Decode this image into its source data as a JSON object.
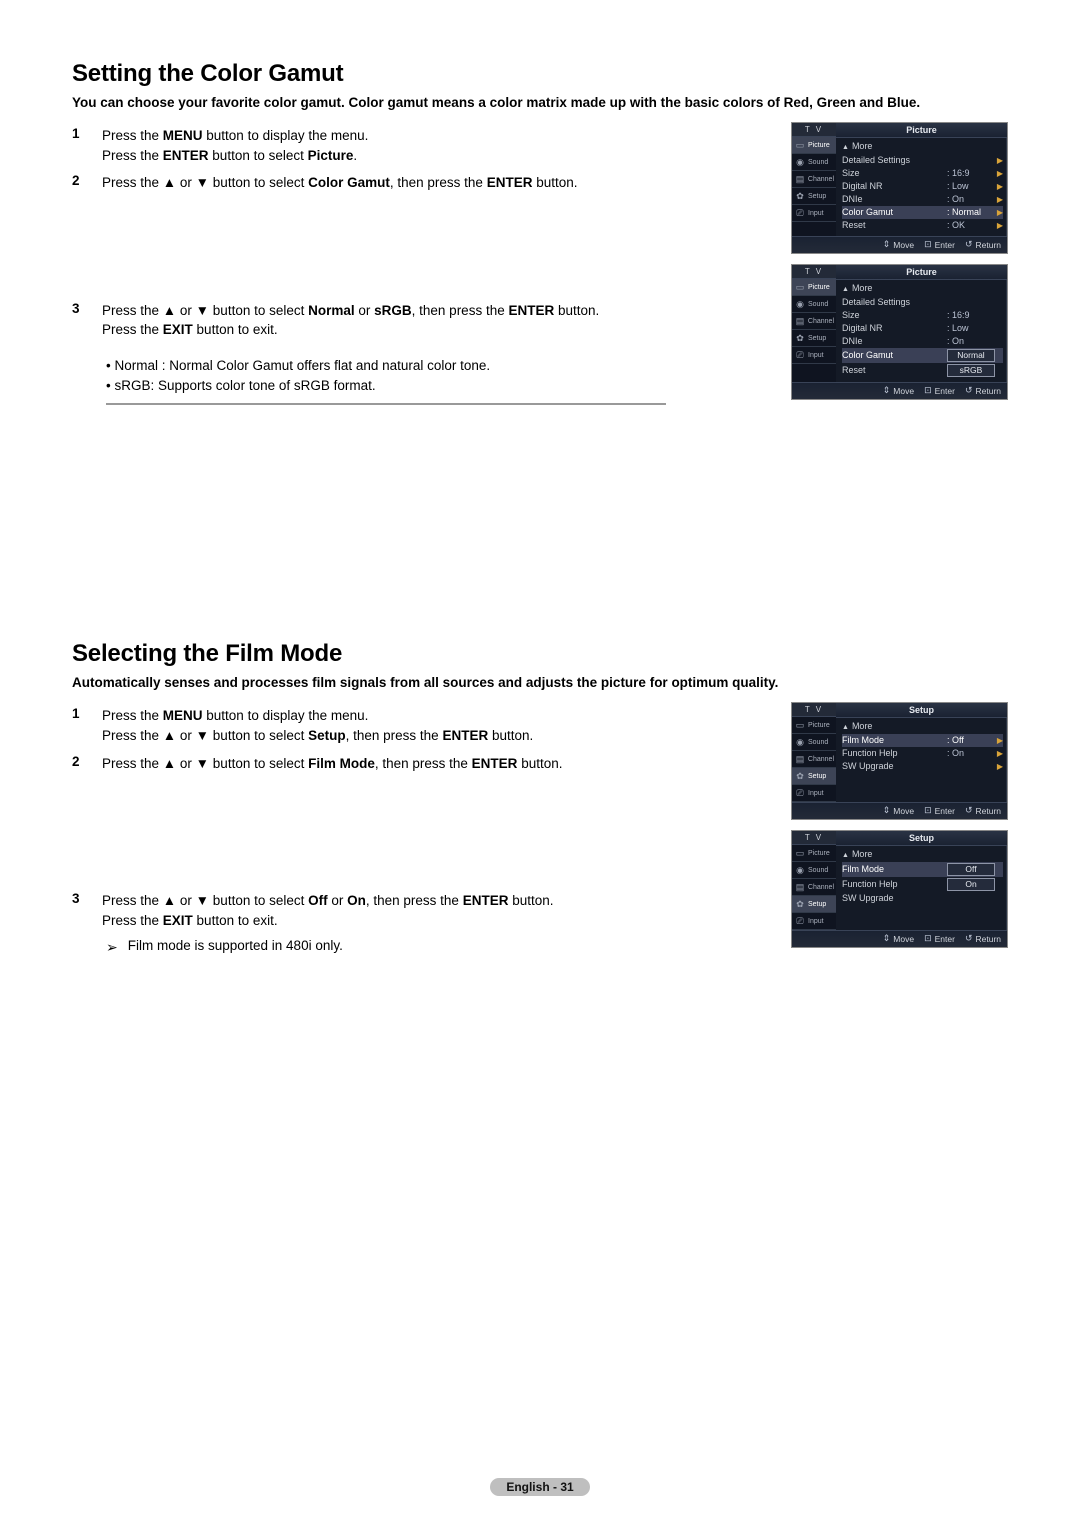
{
  "glyphs": {
    "up": "▲",
    "down": "▼",
    "updown": "▲▼",
    "tri_r": "▶",
    "enter_sym": "⊡",
    "return_sym": "↺",
    "arrow_r": "➤",
    "bullet": "•",
    "note": "➢",
    "updown_sym": "⇕"
  },
  "section1": {
    "heading": "Setting the Color Gamut",
    "intro": "You can choose your favorite color gamut. Color gamut means a color matrix made up with the basic colors of Red, Green and Blue.",
    "step1": {
      "num": "1",
      "l1a": "Press the ",
      "l1b": "MENU",
      "l1c": " button to display the menu.",
      "l2a": "Press the ",
      "l2b": "ENTER",
      "l2c": " button to select ",
      "l2d": "Picture",
      "l2e": "."
    },
    "step2": {
      "num": "2",
      "a": "Press the ",
      "b": " or ",
      "c": " button to select ",
      "d": "Color Gamut",
      "e": ", then press the ",
      "f": "ENTER",
      "g": " button."
    },
    "step3": {
      "num": "3",
      "a": "Press the ",
      "b": " or ",
      "c": " button to select ",
      "d": "Normal",
      "e": " or ",
      "f": "sRGB",
      "g": ", then press the ",
      "h": "ENTER",
      "i": " button.",
      "l2a": "Press the ",
      "l2b": "EXIT",
      "l2c": " button to exit."
    },
    "bul1": {
      "a": "Normal",
      "b": " : Normal Color Gamut offers flat and natural color tone."
    },
    "bul2": {
      "a": "sRGB",
      "b": ": Supports color tone of sRGB format."
    },
    "osd1": {
      "title": "Picture",
      "more": "More",
      "rows": [
        {
          "label": "Detailed Settings",
          "val": "",
          "arrow": true
        },
        {
          "label": "Size",
          "val": ": 16:9",
          "arrow": true
        },
        {
          "label": "Digital NR",
          "val": ": Low",
          "arrow": true
        },
        {
          "label": "DNIe",
          "val": ": On",
          "arrow": true
        },
        {
          "label": "Color Gamut",
          "val": ": Normal",
          "arrow": true,
          "hl": true
        },
        {
          "label": "Reset",
          "val": ": OK",
          "arrow": true
        }
      ]
    },
    "osd2": {
      "title": "Picture",
      "more": "More",
      "rows": [
        {
          "label": "Detailed Settings",
          "val": ""
        },
        {
          "label": "Size",
          "val": ": 16:9"
        },
        {
          "label": "Digital NR",
          "val": ": Low"
        },
        {
          "label": "DNIe",
          "val": ": On"
        },
        {
          "label": "Color Gamut",
          "opt": "Normal",
          "hl": true
        },
        {
          "label": "Reset",
          "opt": "sRGB"
        }
      ]
    }
  },
  "section2": {
    "heading": "Selecting the Film Mode",
    "intro": "Automatically senses and processes film signals from all sources and adjusts the picture for optimum quality.",
    "step1": {
      "num": "1",
      "l1a": "Press the ",
      "l1b": "MENU",
      "l1c": " button to display the menu.",
      "l2a": "Press the ",
      "l2b": " or ",
      "l2c": " button to select ",
      "l2d": "Setup",
      "l2e": ", then press the ",
      "l2f": "ENTER",
      "l2g": " button."
    },
    "step2": {
      "num": "2",
      "a": "Press the ",
      "b": " or ",
      "c": " button to select ",
      "d": "Film Mode",
      "e": ", then press the ",
      "f": "ENTER",
      "g": " button."
    },
    "step3": {
      "num": "3",
      "a": "Press the ",
      "b": " or ",
      "c": " button to select ",
      "d": "Off",
      "e": " or ",
      "f": "On",
      "g": ", then press the ",
      "h": "ENTER",
      "i": " button.",
      "l2a": "Press the ",
      "l2b": "EXIT",
      "l2c": " button to exit."
    },
    "note": "Film mode is supported in 480i only.",
    "osd1": {
      "title": "Setup",
      "more": "More",
      "rows": [
        {
          "label": "Film Mode",
          "val": ": Off",
          "arrow": true,
          "hl": true
        },
        {
          "label": "Function Help",
          "val": ": On",
          "arrow": true
        },
        {
          "label": "SW Upgrade",
          "val": "",
          "arrow": true
        }
      ]
    },
    "osd2": {
      "title": "Setup",
      "more": "More",
      "rows": [
        {
          "label": "Film Mode",
          "opt": "Off",
          "hl": true
        },
        {
          "label": "Function Help",
          "opt": "On"
        },
        {
          "label": "SW Upgrade",
          "val": ""
        }
      ]
    }
  },
  "osd_common": {
    "tv": "T V",
    "side": [
      "Picture",
      "Sound",
      "Channel",
      "Setup",
      "Input"
    ],
    "footer": {
      "move": "Move",
      "enter": "Enter",
      "return": "Return"
    }
  },
  "footer": "English - 31"
}
